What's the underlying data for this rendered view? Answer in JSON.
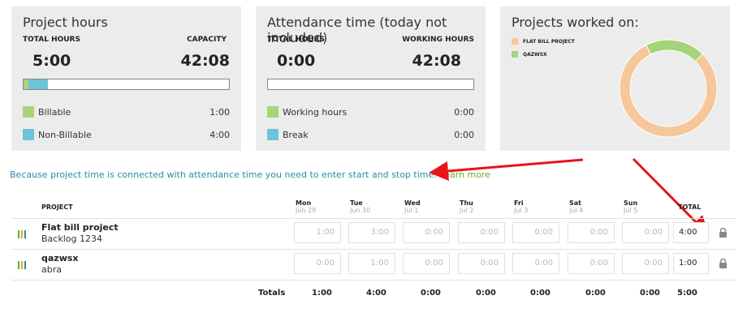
{
  "project_hours": {
    "title": "Project hours",
    "total_label": "TOTAL HOURS",
    "capacity_label": "CAPACITY",
    "total_value": "5:00",
    "capacity_value": "42:08",
    "bar_segments": [
      {
        "name": "Billable",
        "fraction": 0.024,
        "color": "#a6d47a"
      },
      {
        "name": "Non-Billable",
        "fraction": 0.095,
        "color": "#6cc5d6"
      }
    ],
    "legend": [
      {
        "label": "Billable",
        "value": "1:00",
        "color": "#a6d47a"
      },
      {
        "label": "Non-Billable",
        "value": "4:00",
        "color": "#6cc5d6"
      }
    ]
  },
  "attendance": {
    "title": "Attendance time (today not included)",
    "total_label": "TOTAL HOURS",
    "working_label": "WORKING HOURS",
    "total_value": "0:00",
    "working_value": "42:08",
    "legend": [
      {
        "label": "Working hours",
        "value": "0:00",
        "color": "#a6d47a"
      },
      {
        "label": "Break",
        "value": "0:00",
        "color": "#6cc5d6"
      }
    ]
  },
  "projects_worked": {
    "title": "Projects worked on:",
    "legend": [
      {
        "label": "FLAT BILL PROJECT",
        "color": "#f5c79a"
      },
      {
        "label": "QAZWSX",
        "color": "#a6d47a"
      }
    ],
    "chart_data": {
      "type": "pie",
      "categories": [
        "FLAT BILL PROJECT",
        "QAZWSX"
      ],
      "values": [
        4,
        1
      ],
      "colors": [
        "#f5c79a",
        "#a6d47a"
      ]
    }
  },
  "info": {
    "text": "Because project time is connected with attendance time you need to enter start and stop time.",
    "link": "Learn more"
  },
  "table": {
    "project_header": "PROJECT",
    "total_header": "TOTAL",
    "days": [
      {
        "name": "Mon",
        "date": "Jun 29"
      },
      {
        "name": "Tue",
        "date": "Jun 30"
      },
      {
        "name": "Wed",
        "date": "Jul 1"
      },
      {
        "name": "Thu",
        "date": "Jul 2"
      },
      {
        "name": "Fri",
        "date": "Jul 3"
      },
      {
        "name": "Sat",
        "date": "Jul 4"
      },
      {
        "name": "Sun",
        "date": "Jul 5"
      }
    ],
    "rows": [
      {
        "name": "Flat bill project",
        "sub": "Backlog 1234",
        "icon_colors": [
          "#6aaa2a",
          "#e5a82a",
          "#2a8ca0"
        ],
        "cells": [
          "1:00",
          "3:00",
          "0:00",
          "0:00",
          "0:00",
          "0:00",
          "0:00"
        ],
        "total": "4:00"
      },
      {
        "name": "qazwsx",
        "sub": "abra",
        "icon_colors": [
          "#6aaa2a",
          "#e5a82a",
          "#2a8ca0"
        ],
        "cells": [
          "0:00",
          "1:00",
          "0:00",
          "0:00",
          "0:00",
          "0:00",
          "0:00"
        ],
        "total": "1:00"
      }
    ],
    "totals_label": "Totals",
    "totals": [
      "1:00",
      "4:00",
      "0:00",
      "0:00",
      "0:00",
      "0:00",
      "0:00"
    ],
    "grand_total": "5:00"
  },
  "annotation_color": "#e8141a"
}
